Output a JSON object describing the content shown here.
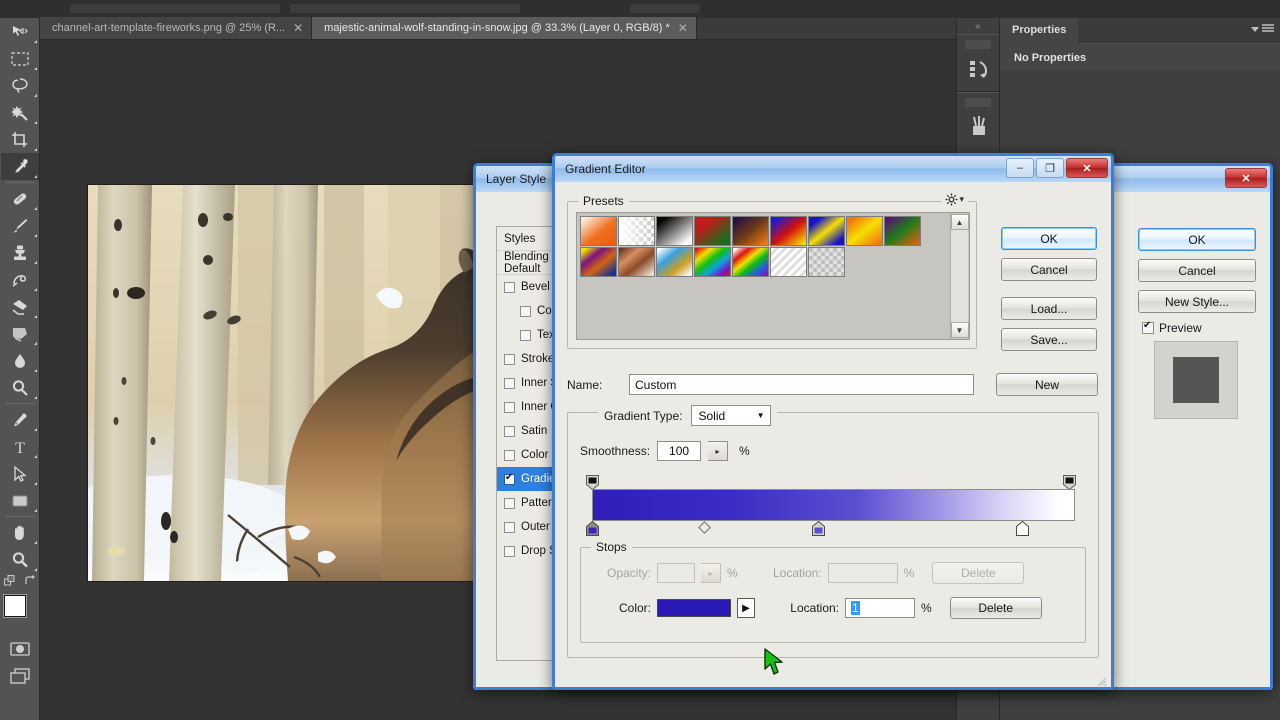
{
  "app": {
    "tabs": [
      {
        "label": "channel-art-template-fireworks.png @ 25% (R...",
        "close": "✕",
        "active": false
      },
      {
        "label": "majestic-animal-wolf-standing-in-snow.jpg @ 33.3% (Layer 0, RGB/8) *",
        "close": "✕",
        "active": true
      }
    ]
  },
  "toolbar": {
    "tools": [
      {
        "name": "move-tool"
      },
      {
        "name": "rectangular-marquee-tool"
      },
      {
        "name": "lasso-tool"
      },
      {
        "name": "magic-wand-tool"
      },
      {
        "name": "crop-tool"
      },
      {
        "name": "eyedropper-tool"
      },
      {
        "name": "healing-brush-tool"
      },
      {
        "name": "brush-tool"
      },
      {
        "name": "clone-stamp-tool"
      },
      {
        "name": "history-brush-tool"
      },
      {
        "name": "eraser-tool"
      },
      {
        "name": "gradient-tool"
      },
      {
        "name": "blur-tool"
      },
      {
        "name": "dodge-tool"
      },
      {
        "name": "pen-tool"
      },
      {
        "name": "type-tool"
      },
      {
        "name": "path-selection-tool"
      },
      {
        "name": "rectangle-tool"
      },
      {
        "name": "hand-tool"
      },
      {
        "name": "zoom-tool"
      }
    ],
    "foreground_color": "#ffffff",
    "background_color": "#f15a22"
  },
  "properties_panel": {
    "tab_label": "Properties",
    "empty_text": "No Properties"
  },
  "layer_style": {
    "title": "Layer Style",
    "window_buttons": {
      "close": "✕"
    },
    "items": [
      {
        "label": "Styles",
        "type": "header"
      },
      {
        "label": "Blending Options: Default",
        "type": "header"
      },
      {
        "label": "Bevel & Emboss",
        "type": "check",
        "checked": false
      },
      {
        "label": "Contour",
        "type": "check",
        "checked": false,
        "sub": true
      },
      {
        "label": "Texture",
        "type": "check",
        "checked": false,
        "sub": true
      },
      {
        "label": "Stroke",
        "type": "check",
        "checked": false
      },
      {
        "label": "Inner Shadow",
        "type": "check",
        "checked": false
      },
      {
        "label": "Inner Glow",
        "type": "check",
        "checked": false
      },
      {
        "label": "Satin",
        "type": "check",
        "checked": false
      },
      {
        "label": "Color Overlay",
        "type": "check",
        "checked": false
      },
      {
        "label": "Gradient Overlay",
        "type": "check",
        "checked": true,
        "active": true
      },
      {
        "label": "Pattern Overlay",
        "type": "check",
        "checked": false
      },
      {
        "label": "Outer Glow",
        "type": "check",
        "checked": false
      },
      {
        "label": "Drop Shadow",
        "type": "check",
        "checked": false
      }
    ],
    "buttons": {
      "ok": "OK",
      "cancel": "Cancel",
      "new_style": "New Style..."
    },
    "preview_label": "Preview",
    "preview_checked": true
  },
  "gradient_editor": {
    "title": "Gradient Editor",
    "window_buttons": {
      "minimize": "–",
      "maximize": "❐",
      "close": "✕"
    },
    "presets": {
      "legend": "Presets",
      "gear_icon": "gear-icon",
      "scroll_up": "▲",
      "scroll_down": "▼",
      "swatches": [
        {
          "name": "foreground-to-background",
          "css": "linear-gradient(to bottom right, #ffffff 0%, #f07020 55%, #e85c10 100%)"
        },
        {
          "name": "foreground-to-transparent",
          "css": "linear-gradient(to bottom right, #ffffff, #e8e8e8)"
        },
        {
          "name": "black-white",
          "css": "linear-gradient(to bottom right, #000000 15%, #ffffff 85%)"
        },
        {
          "name": "red-green",
          "css": "linear-gradient(to bottom right, #c21b1b 30%, #1e6b1e 80%)"
        },
        {
          "name": "violet-orange",
          "css": "linear-gradient(to bottom right, #2c1040 10%, #6b3a18 50%, #f07a10 95%)"
        },
        {
          "name": "blue-red-yellow",
          "css": "linear-gradient(to bottom right, #1a1ad0 10%, #d01010 50%, #f5e000 95%)"
        },
        {
          "name": "blue-yellow-blue",
          "css": "linear-gradient(to bottom right, #1414c8 18%, #f5e000 50%, #1414c8 85%)"
        },
        {
          "name": "orange-yellow-orange",
          "css": "linear-gradient(to bottom right, #f07a10 15%, #f5e000 50%, #f07a10 90%)"
        },
        {
          "name": "violet-green-orange",
          "css": "linear-gradient(to bottom right, #5a1470 10%, #1e7a1e 45%, #d06410 90%)"
        },
        {
          "name": "yellow-violet-orange-blue",
          "css": "linear-gradient(to bottom right, #f5e000 8%, #7a1480 30%, #d06410 55%, #10309a 90%)"
        },
        {
          "name": "copper",
          "css": "linear-gradient(to bottom right, #6b3a22 5%, #d89060 35%, #8a4a28 60%, #f0e0d0 95%)"
        },
        {
          "name": "chrome",
          "css": "linear-gradient(to bottom right, #ffffff 5%, #3aa0e0 35%, #caa020 65%, #ffffff 95%)"
        },
        {
          "name": "spectrum",
          "css": "linear-gradient(to bottom right, #e01010 5%, #f5e000 25%, #10c010 45%, #10a0e0 65%, #8010c0 85%, #e01010 98%)"
        },
        {
          "name": "transparent-rainbow",
          "css": "linear-gradient(to bottom right, #ffffff 5%, #e01010 25%, #f5e000 42%, #10c010 58%, #2060e0 78%, #9010c0 95%)"
        },
        {
          "name": "transparent-stripes",
          "css": "linear-gradient(135deg, #ffffff 0%, #e4e4e4 100%)"
        },
        {
          "name": "neutral-density",
          "css": "linear-gradient(to bottom right, #e0e0e0, #b8b8b8)"
        }
      ]
    },
    "name_label": "Name:",
    "name_value": "Custom",
    "new_button": "New",
    "gradient_type_label": "Gradient Type:",
    "gradient_type_value": "Solid",
    "smoothness_label": "Smoothness:",
    "smoothness_value": "100",
    "percent": "%",
    "gradient_bar": {
      "css": "linear-gradient(to right, #2f1fb8 0%, #3a2cc4 28%, #5b4fd0 55%, #9f96e6 72%, #d8d3f5 85%, #ffffff 97%)",
      "opacity_stops": [
        {
          "position_pct": 0
        },
        {
          "position_pct": 100
        }
      ],
      "color_stops": [
        {
          "position_pct": 0,
          "color": "#3a27c2",
          "selected": true
        },
        {
          "position_pct": 47,
          "color": "#5b4fd0",
          "selected": false
        },
        {
          "position_pct": 89,
          "color": "#ffffff",
          "selected": false
        }
      ],
      "midpoints": [
        {
          "position_pct": 24
        }
      ]
    },
    "stops": {
      "legend": "Stops",
      "opacity_label": "Opacity:",
      "opacity_value": "",
      "opacity_location_label": "Location:",
      "opacity_location_value": "",
      "opacity_delete": "Delete",
      "color_label": "Color:",
      "color_value": "#2a1ab5",
      "color_arrow": "▶",
      "color_location_label": "Location:",
      "color_location_value": "1",
      "color_delete": "Delete"
    },
    "buttons": {
      "ok": "OK",
      "cancel": "Cancel",
      "load": "Load...",
      "save": "Save..."
    }
  }
}
